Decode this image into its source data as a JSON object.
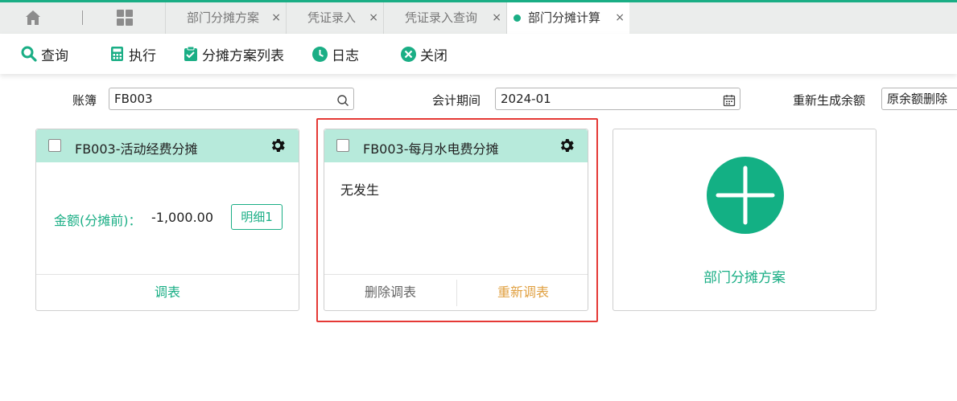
{
  "tabs": [
    {
      "label": "部门分摊方案",
      "closable": true,
      "active": false
    },
    {
      "label": "凭证录入",
      "closable": true,
      "active": false
    },
    {
      "label": "凭证录入查询",
      "closable": true,
      "active": false
    },
    {
      "label": "部门分摊计算",
      "closable": true,
      "active": true
    }
  ],
  "tab_close_glyph": "×",
  "toolbar": {
    "query": "查询",
    "execute": "执行",
    "scheme_list": "分摊方案列表",
    "log": "日志",
    "close": "关闭"
  },
  "filters": {
    "ledger_label": "账簿",
    "ledger_value": "FB003",
    "period_label": "会计期间",
    "period_value": "2024-01",
    "regen_label": "重新生成余额",
    "regen_value": "原余额删除"
  },
  "cards": [
    {
      "title": "FB003-活动经费分摊",
      "amount_label": "金额(分摊前)：",
      "amount_value": "-1,000.00",
      "detail_button": "明细1",
      "footer_button": "调表"
    },
    {
      "title": "FB003-每月水电费分摊",
      "status_text": "无发生",
      "delete_button": "删除调表",
      "regen_button": "重新调表"
    }
  ],
  "add_card": {
    "label": "部门分摊方案"
  },
  "colors": {
    "accent": "#1aae85",
    "card_header": "#b7eadb",
    "highlight": "#e53935",
    "regen_text": "#e0a041"
  },
  "icons": {
    "home": "home-icon",
    "grid": "grid-icon",
    "search": "search-icon",
    "execute": "calculator-icon",
    "scheme_list": "clipboard-icon",
    "log": "clock-icon",
    "close": "close-circle-icon",
    "settings": "gear-icon",
    "calendar": "calendar-icon",
    "add": "plus-icon"
  }
}
